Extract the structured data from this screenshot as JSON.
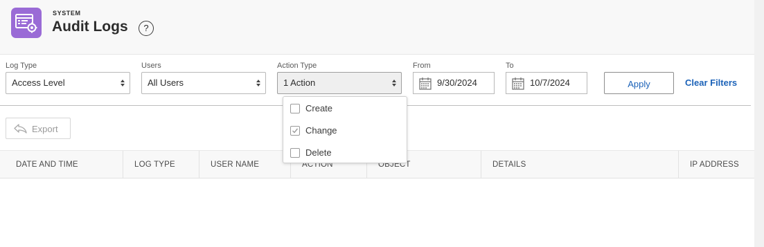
{
  "header": {
    "eyebrow": "SYSTEM",
    "title": "Audit Logs",
    "help": "?",
    "app_icon": "audit-settings-icon"
  },
  "filters": {
    "log_type": {
      "label": "Log Type",
      "value": "Access Level"
    },
    "users": {
      "label": "Users",
      "value": "All Users"
    },
    "action_type": {
      "label": "Action Type",
      "value": "1 Action"
    },
    "from": {
      "label": "From",
      "value": "9/30/2024"
    },
    "to": {
      "label": "To",
      "value": "10/7/2024"
    },
    "apply": "Apply",
    "clear": "Clear Filters"
  },
  "action_dropdown": {
    "options": [
      {
        "label": "Create",
        "checked": false
      },
      {
        "label": "Change",
        "checked": true
      },
      {
        "label": "Delete",
        "checked": false
      }
    ]
  },
  "toolbar": {
    "export": "Export"
  },
  "table": {
    "columns": [
      "DATE AND TIME",
      "LOG TYPE",
      "USER NAME",
      "ACTION",
      "OBJECT",
      "DETAILS",
      "IP ADDRESS"
    ]
  },
  "colors": {
    "brand": "#9a6bd6",
    "link": "#1b62b8"
  }
}
